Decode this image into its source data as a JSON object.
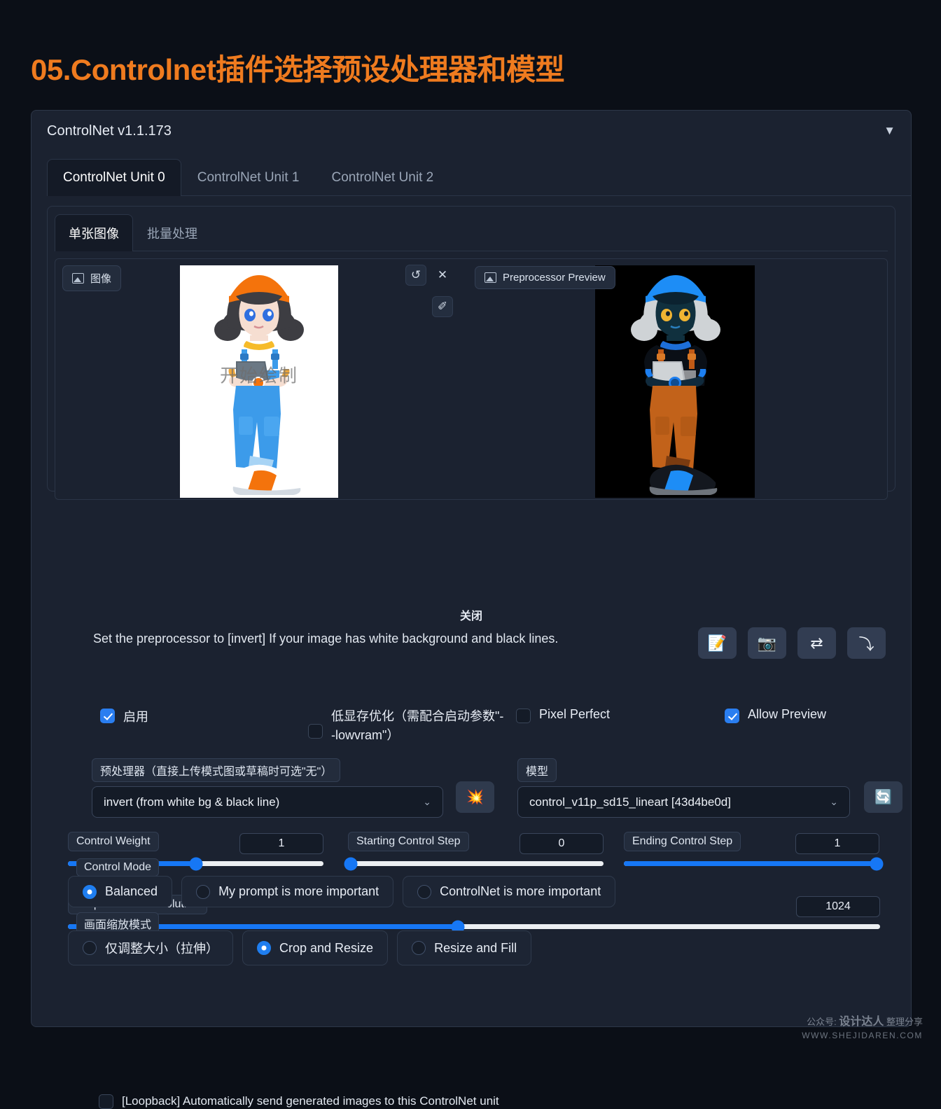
{
  "title": "05.Controlnet插件选择预设处理器和模型",
  "panel": {
    "title": "ControlNet v1.1.173",
    "collapse_icon": "chevron-down-icon",
    "collapse_glyph": "▼"
  },
  "unit_tabs": [
    {
      "label": "ControlNet Unit 0",
      "active": true
    },
    {
      "label": "ControlNet Unit 1",
      "active": false
    },
    {
      "label": "ControlNet Unit 2",
      "active": false
    }
  ],
  "sub_tabs": [
    {
      "label": "单张图像",
      "active": true
    },
    {
      "label": "批量处理",
      "active": false
    }
  ],
  "image_panel": {
    "source_badge": "图像",
    "preview_badge": "Preprocessor Preview",
    "source_watermark": "开始绘制",
    "close_label": "关闭",
    "tools": [
      {
        "name": "undo-icon",
        "glyph": "↺"
      },
      {
        "name": "close-icon",
        "glyph": "✕"
      },
      {
        "name": "edit-draw-icon",
        "glyph": "✐"
      }
    ]
  },
  "hint": {
    "text": "Set the preprocessor to [invert] If your image has white background and black lines."
  },
  "action_buttons": [
    {
      "name": "open-new-canvas-button",
      "glyph": "📝"
    },
    {
      "name": "webcam-button",
      "glyph": "📷"
    },
    {
      "name": "swap-button",
      "glyph": "⇄"
    },
    {
      "name": "send-dimensions-button",
      "glyph": "⤵"
    }
  ],
  "checkboxes": [
    {
      "label": "启用",
      "checked": true
    },
    {
      "label": "低显存优化（需配合启动参数\"--lowvram\"）",
      "checked": false
    },
    {
      "label": "Pixel Perfect",
      "checked": false
    },
    {
      "label": "Allow Preview",
      "checked": true
    }
  ],
  "preprocessor": {
    "label": "预处理器（直接上传模式图或草稿时可选\"无\"）",
    "value": "invert (from white bg & black line)",
    "chevron": "⌄",
    "run_button_icon": "💥"
  },
  "model": {
    "label": "模型",
    "value": "control_v11p_sd15_lineart [43d4be0d]",
    "chevron": "⌄",
    "refresh_button_icon": "🔄"
  },
  "sliders": [
    {
      "label": "Control Weight",
      "value": "1",
      "percent": 50
    },
    {
      "label": "Starting Control Step",
      "value": "0",
      "percent": 0
    },
    {
      "label": "Ending Control Step",
      "value": "1",
      "percent": 100
    },
    {
      "label": "Preprocessor Resolution",
      "value": "1024",
      "percent": 48
    }
  ],
  "control_mode": {
    "label": "Control Mode",
    "options": [
      {
        "label": "Balanced",
        "selected": true
      },
      {
        "label": "My prompt is more important",
        "selected": false
      },
      {
        "label": "ControlNet is more important",
        "selected": false
      }
    ]
  },
  "resize_mode": {
    "label": "画面缩放模式",
    "options": [
      {
        "label": "仅调整大小（拉伸）",
        "selected": false
      },
      {
        "label": "Crop and Resize",
        "selected": true
      },
      {
        "label": "Resize and Fill",
        "selected": false
      }
    ]
  },
  "loopback": {
    "label": "[Loopback] Automatically send generated images to this ControlNet unit",
    "checked": false
  },
  "site_watermark": {
    "line1_prefix": "公众号: ",
    "line1_brand": "设计达人",
    "line1_suffix": " 整理分享",
    "line2": "WWW.SHEJIDAREN.COM"
  },
  "colors": {
    "accent_orange": "#ef7b1f",
    "accent_blue": "#1677f5",
    "panel_bg": "#1b2230",
    "page_bg": "#0b0f17"
  }
}
